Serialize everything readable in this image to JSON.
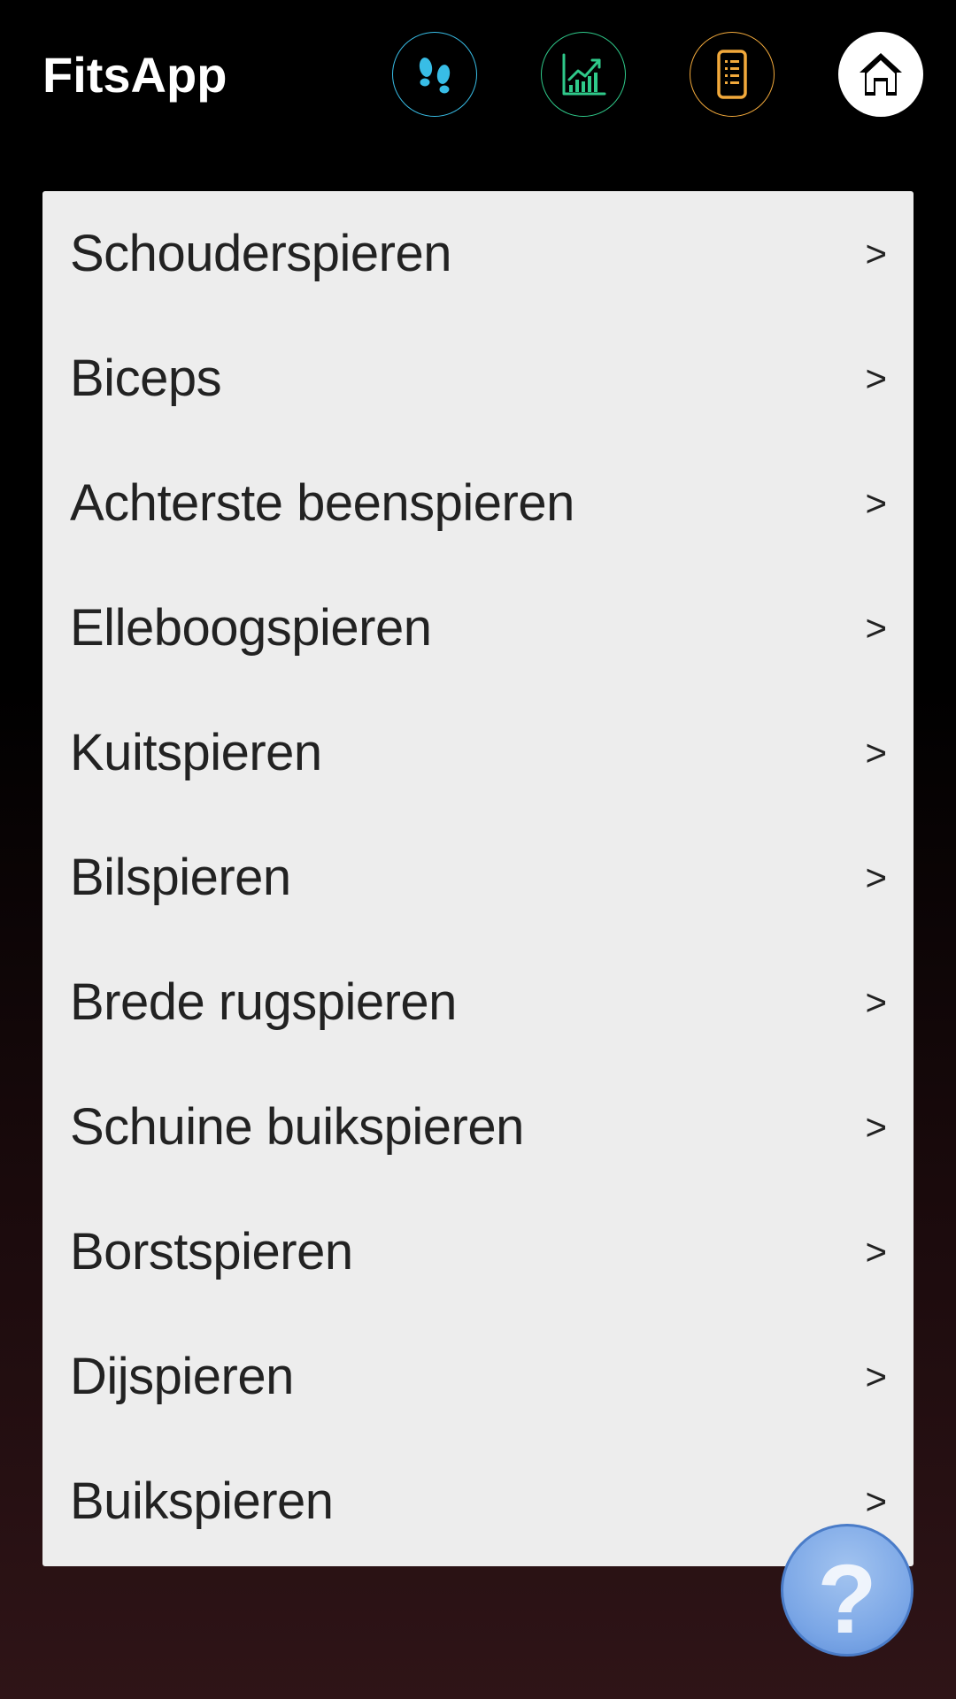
{
  "header": {
    "title": "FitsApp",
    "nav": [
      {
        "name": "steps-icon",
        "color": "#38bde6"
      },
      {
        "name": "stats-chart-icon",
        "color": "#2fc98a"
      },
      {
        "name": "list-icon",
        "color": "#f2a93b"
      },
      {
        "name": "home-icon",
        "color": "#000000"
      }
    ]
  },
  "muscle_groups": [
    {
      "label": "Schouderspieren",
      "chevron": ">"
    },
    {
      "label": "Biceps",
      "chevron": ">"
    },
    {
      "label": "Achterste beenspieren",
      "chevron": ">"
    },
    {
      "label": "Elleboogspieren",
      "chevron": ">"
    },
    {
      "label": "Kuitspieren",
      "chevron": ">"
    },
    {
      "label": "Bilspieren",
      "chevron": ">"
    },
    {
      "label": "Brede rugspieren",
      "chevron": ">"
    },
    {
      "label": "Schuine buikspieren",
      "chevron": ">"
    },
    {
      "label": "Borstspieren",
      "chevron": ">"
    },
    {
      "label": "Dijspieren",
      "chevron": ">"
    },
    {
      "label": "Buikspieren",
      "chevron": ">"
    }
  ],
  "help": {
    "label": "?"
  }
}
